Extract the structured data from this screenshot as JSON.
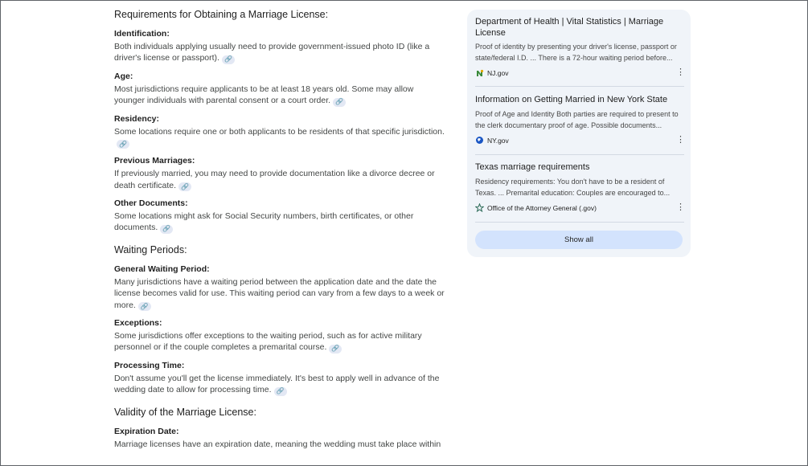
{
  "sections": [
    {
      "title": "Requirements for Obtaining a Marriage License:",
      "items": [
        {
          "title": "Identification:",
          "text": "Both individuals applying usually need to provide government-issued photo ID (like a driver's license or passport)."
        },
        {
          "title": "Age:",
          "text": "Most jurisdictions require applicants to be at least 18 years old. Some may allow younger individuals with parental consent or a court order."
        },
        {
          "title": "Residency:",
          "text": "Some locations require one or both applicants to be residents of that specific jurisdiction."
        },
        {
          "title": "Previous Marriages:",
          "text": "If previously married, you may need to provide documentation like a divorce decree or death certificate."
        },
        {
          "title": "Other Documents:",
          "text": "Some locations might ask for Social Security numbers, birth certificates, or other documents."
        }
      ]
    },
    {
      "title": "Waiting Periods:",
      "items": [
        {
          "title": "General Waiting Period:",
          "text": "Many jurisdictions have a waiting period between the application date and the date the license becomes valid for use. This waiting period can vary from a few days to a week or more."
        },
        {
          "title": "Exceptions:",
          "text": "Some jurisdictions offer exceptions to the waiting period, such as for active military personnel or if the couple completes a premarital course."
        },
        {
          "title": "Processing Time:",
          "text": "Don't assume you'll get the license immediately. It's best to apply well in advance of the wedding date to allow for processing time."
        }
      ]
    },
    {
      "title": "Validity of the Marriage License:",
      "items": [
        {
          "title": "Expiration Date:",
          "text": "Marriage licenses have an expiration date, meaning the wedding must take place within"
        }
      ]
    }
  ],
  "link_icon": "🔗",
  "sources": [
    {
      "title": "Department of Health | Vital Statistics | Marriage License",
      "snippet": "Proof of identity by presenting your driver's license, passport or state/federal I.D. ... There is a 72-hour waiting period before...",
      "site": "NJ.gov",
      "icon": "nj-seal-icon"
    },
    {
      "title": "Information on Getting Married in New York State",
      "snippet": "Proof of Age and Identity Both parties are required to present to the clerk documentary proof of age. Possible documents...",
      "site": "NY.gov",
      "icon": "globe-icon"
    },
    {
      "title": "Texas marriage requirements",
      "snippet": "Residency requirements: You don't have to be a resident of Texas. ... Premarital education: Couples are encouraged to...",
      "site": "Office of the Attorney General (.gov)",
      "icon": "star-seal-icon"
    }
  ],
  "show_all_label": "Show all",
  "colors": {
    "panel_bg": "#f0f4f9",
    "button_bg": "#d3e3fd",
    "chip_bg": "#e3e8f4"
  }
}
